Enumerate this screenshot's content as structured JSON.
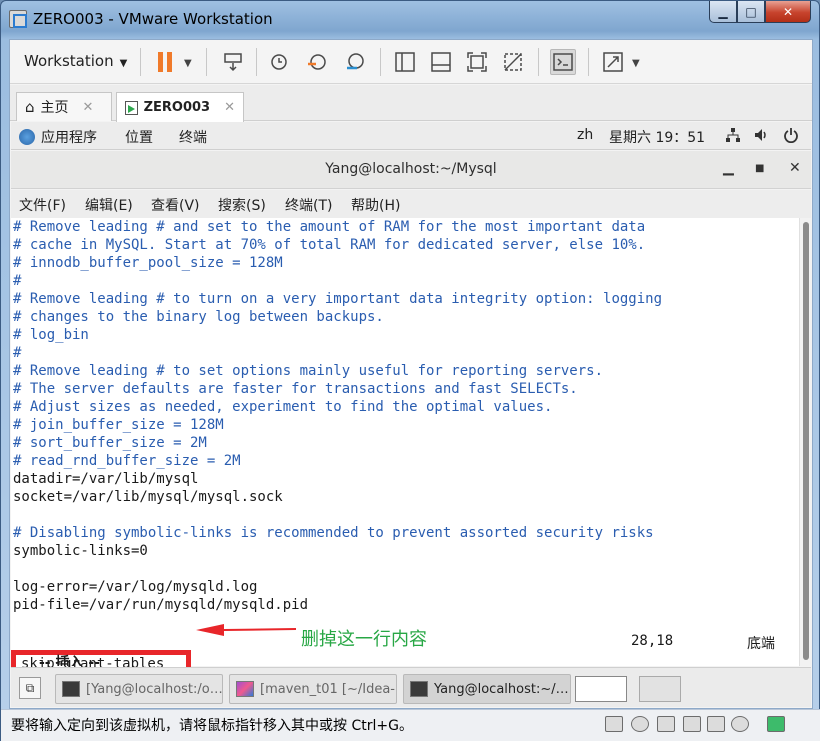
{
  "window": {
    "title": "ZERO003 - VMware Workstation",
    "min": "▁",
    "max": "□",
    "close": "✕"
  },
  "toolbar": {
    "menu_label": "Workstation"
  },
  "tabs": [
    {
      "label": "主页",
      "icon": "home-icon"
    },
    {
      "label": "ZERO003",
      "icon": "vm-icon"
    }
  ],
  "gnome_bar": {
    "apps": "应用程序",
    "places": "位置",
    "terminal": "终端",
    "lang": "zh",
    "clock": "星期六 19：51"
  },
  "terminal": {
    "title": "Yang@localhost:~/Mysql",
    "menu": [
      "文件(F)",
      "编辑(E)",
      "查看(V)",
      "搜索(S)",
      "终端(T)",
      "帮助(H)"
    ],
    "lines": [
      {
        "text": "# Remove leading # and set to the amount of RAM for the most important data",
        "type": "comment"
      },
      {
        "text": "# cache in MySQL. Start at 70% of total RAM for dedicated server, else 10%.",
        "type": "comment"
      },
      {
        "text": "# innodb_buffer_pool_size = 128M",
        "type": "comment"
      },
      {
        "text": "#",
        "type": "comment"
      },
      {
        "text": "# Remove leading # to turn on a very important data integrity option: logging",
        "type": "comment"
      },
      {
        "text": "# changes to the binary log between backups.",
        "type": "comment"
      },
      {
        "text": "# log_bin",
        "type": "comment"
      },
      {
        "text": "#",
        "type": "comment"
      },
      {
        "text": "# Remove leading # to set options mainly useful for reporting servers.",
        "type": "comment"
      },
      {
        "text": "# The server defaults are faster for transactions and fast SELECTs.",
        "type": "comment"
      },
      {
        "text": "# Adjust sizes as needed, experiment to find the optimal values.",
        "type": "comment"
      },
      {
        "text": "# join_buffer_size = 128M",
        "type": "comment"
      },
      {
        "text": "# sort_buffer_size = 2M",
        "type": "comment"
      },
      {
        "text": "# read_rnd_buffer_size = 2M",
        "type": "comment"
      },
      {
        "text": "datadir=/var/lib/mysql",
        "type": "plain"
      },
      {
        "text": "socket=/var/lib/mysql/mysql.sock",
        "type": "plain"
      },
      {
        "text": "",
        "type": "plain"
      },
      {
        "text": "# Disabling symbolic-links is recommended to prevent assorted security risks",
        "type": "comment"
      },
      {
        "text": "symbolic-links=0",
        "type": "plain"
      },
      {
        "text": "",
        "type": "plain"
      },
      {
        "text": "log-error=/var/log/mysqld.log",
        "type": "plain"
      },
      {
        "text": "pid-file=/var/run/mysqld/mysqld.pid",
        "type": "plain"
      }
    ],
    "highlighted_line": "skip-grant-tables",
    "mode": "-- 插入 --",
    "cursor_pos": "28,18",
    "scroll_pos": "底端"
  },
  "annotation": {
    "note": "删掉这一行内容",
    "color": "#e8262a"
  },
  "guest_taskbar": [
    {
      "label": "[Yang@localhost:/o…",
      "active": false
    },
    {
      "label": "[maven_t01 [~/Idea-…",
      "active": false
    },
    {
      "label": "Yang@localhost:~/…",
      "active": true
    }
  ],
  "statusbar": {
    "text": "要将输入定向到该虚拟机，请将鼠标指针移入其中或按 Ctrl+G。"
  }
}
